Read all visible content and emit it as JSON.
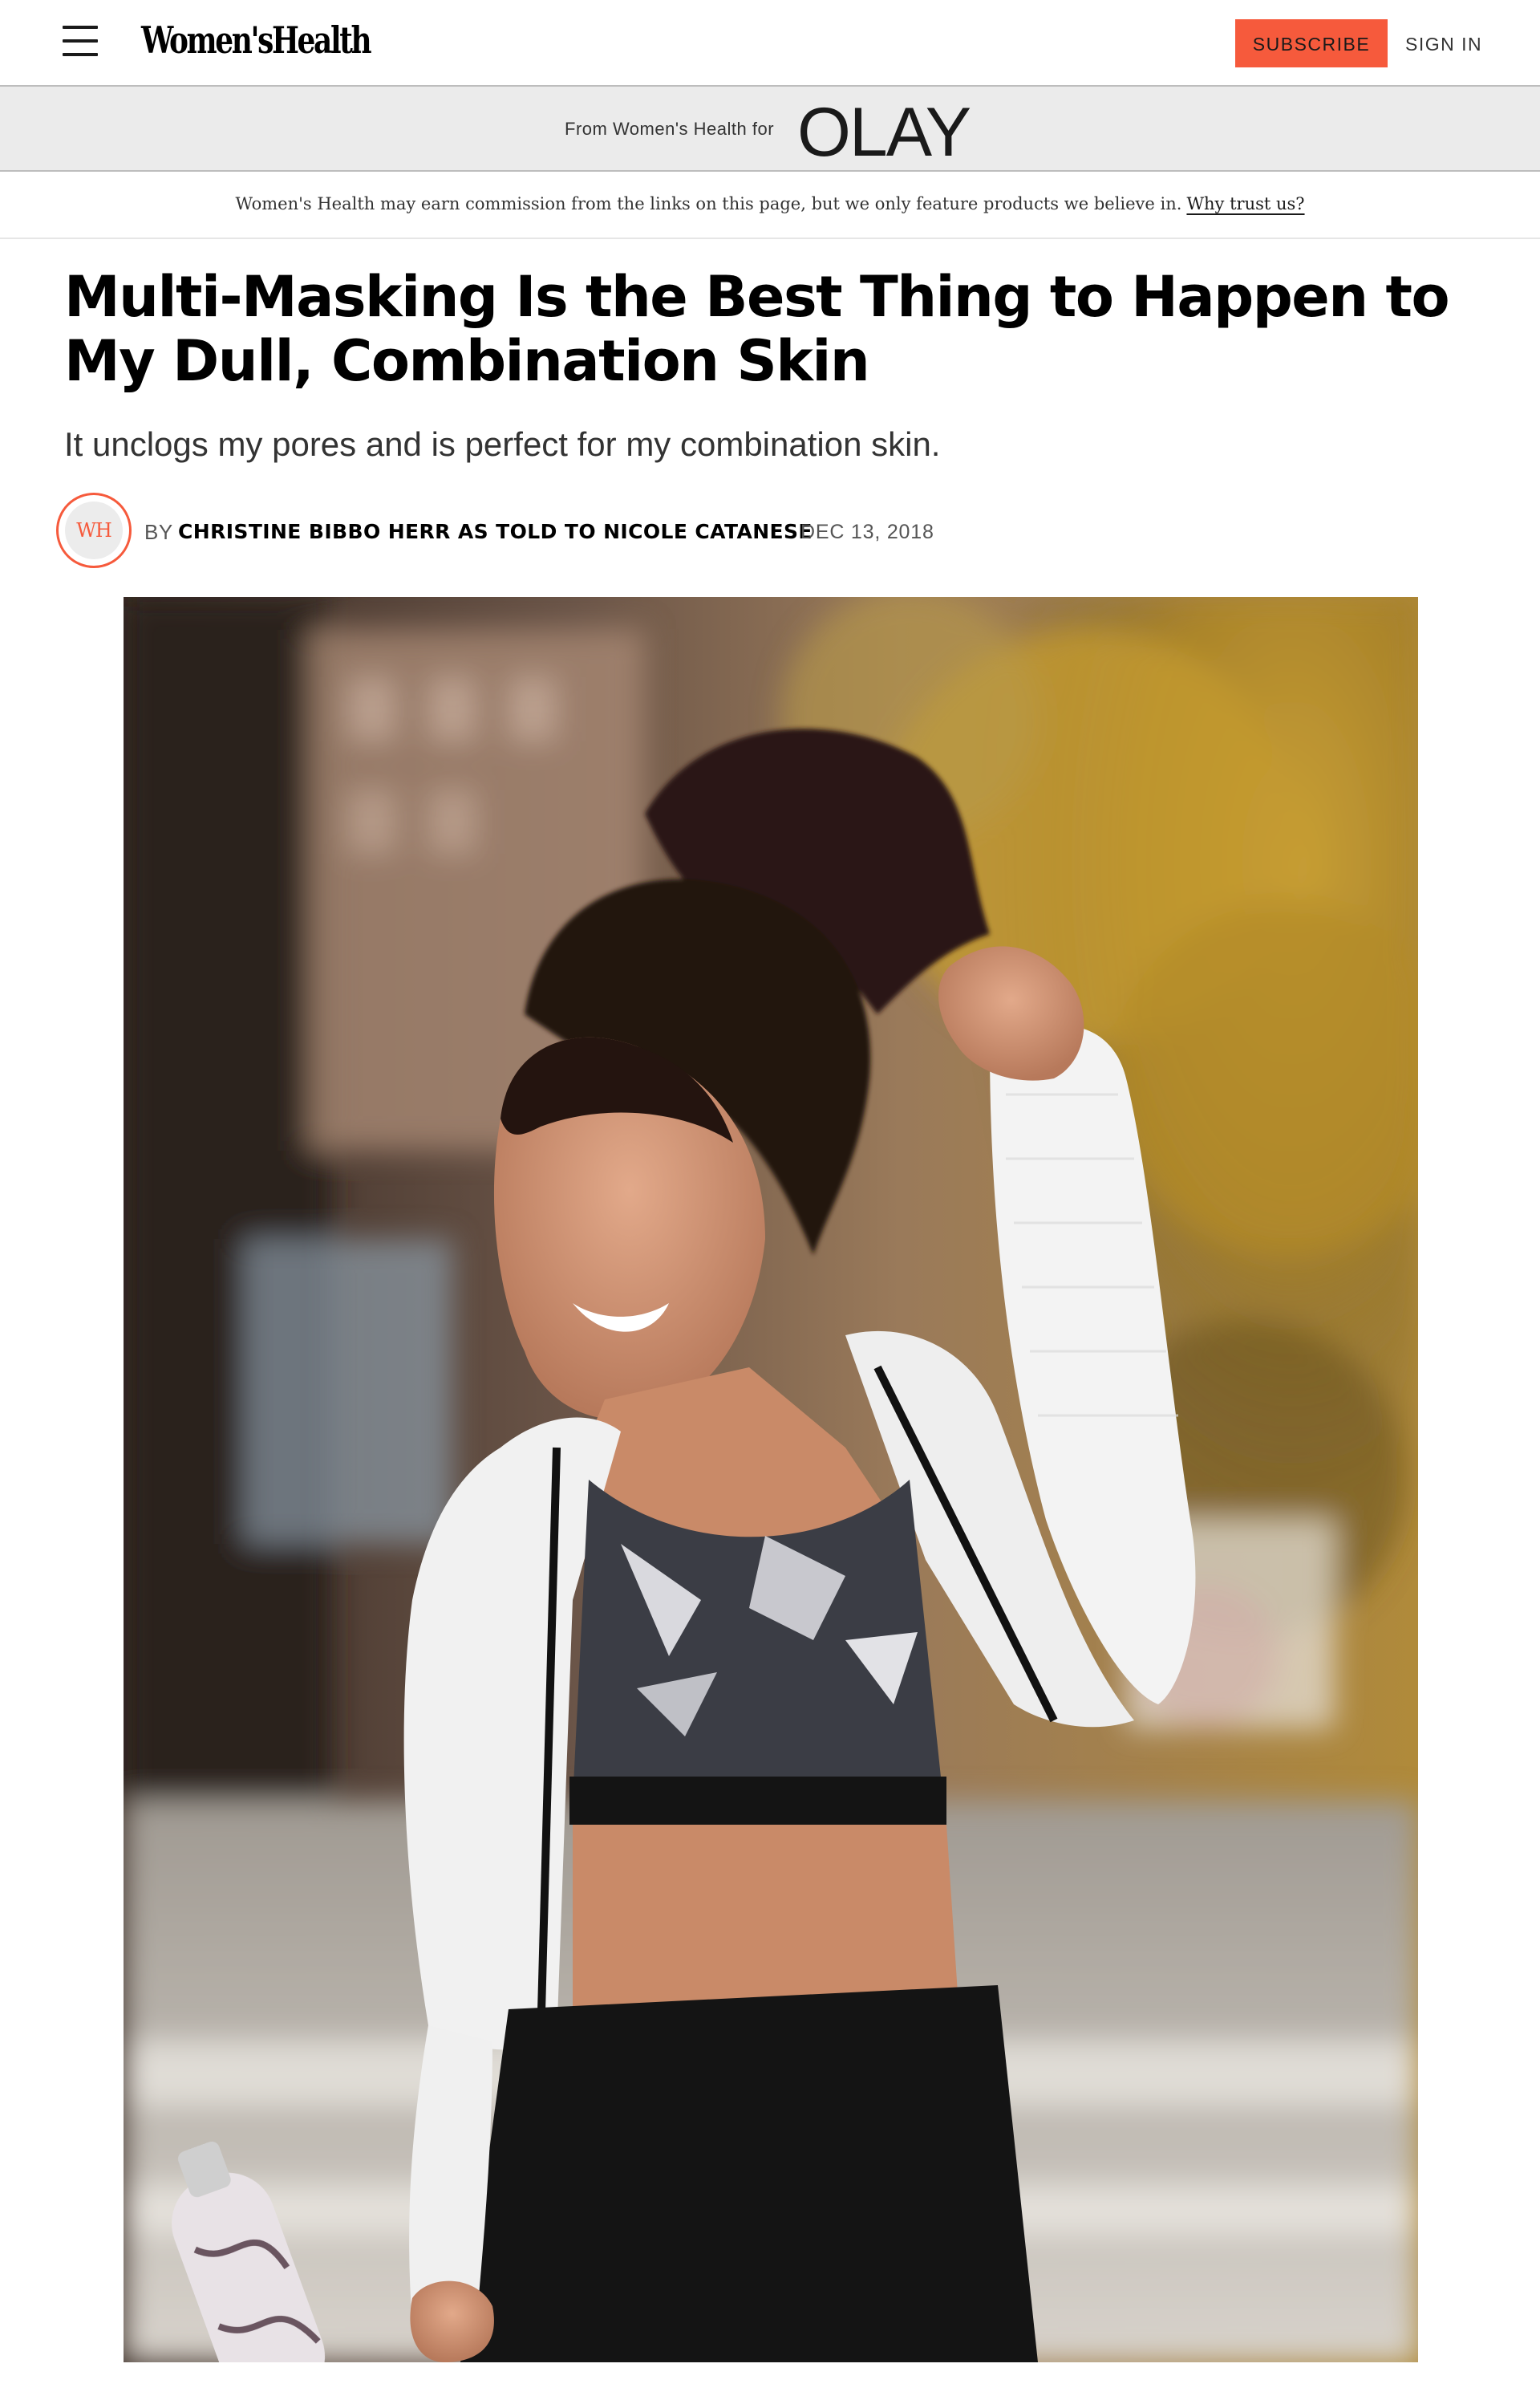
{
  "header": {
    "logo": "Women'sHealth",
    "subscribe_label": "SUBSCRIBE",
    "signin_label": "SIGN IN"
  },
  "sponsor": {
    "text": "From Women's Health for",
    "brand": "OLAY"
  },
  "disclaimer": {
    "text": "Women's Health may earn commission from the links on this page, but we only feature products we believe in.",
    "link_label": "Why trust us?"
  },
  "article": {
    "headline": "Multi-Masking Is the Best Thing to Happen to My Dull, Combination Skin",
    "dek": "It unclogs my pores and is perfect for my combination skin.",
    "byline_prefix": "BY",
    "author": "CHRISTINE BIBBO HERR AS TOLD TO NICOLE CATANESE",
    "date": "DEC 13, 2018",
    "avatar_initials": "WH"
  },
  "colors": {
    "accent": "#f65a3c",
    "sponsor_bg": "#ebebeb",
    "text": "#000000"
  }
}
